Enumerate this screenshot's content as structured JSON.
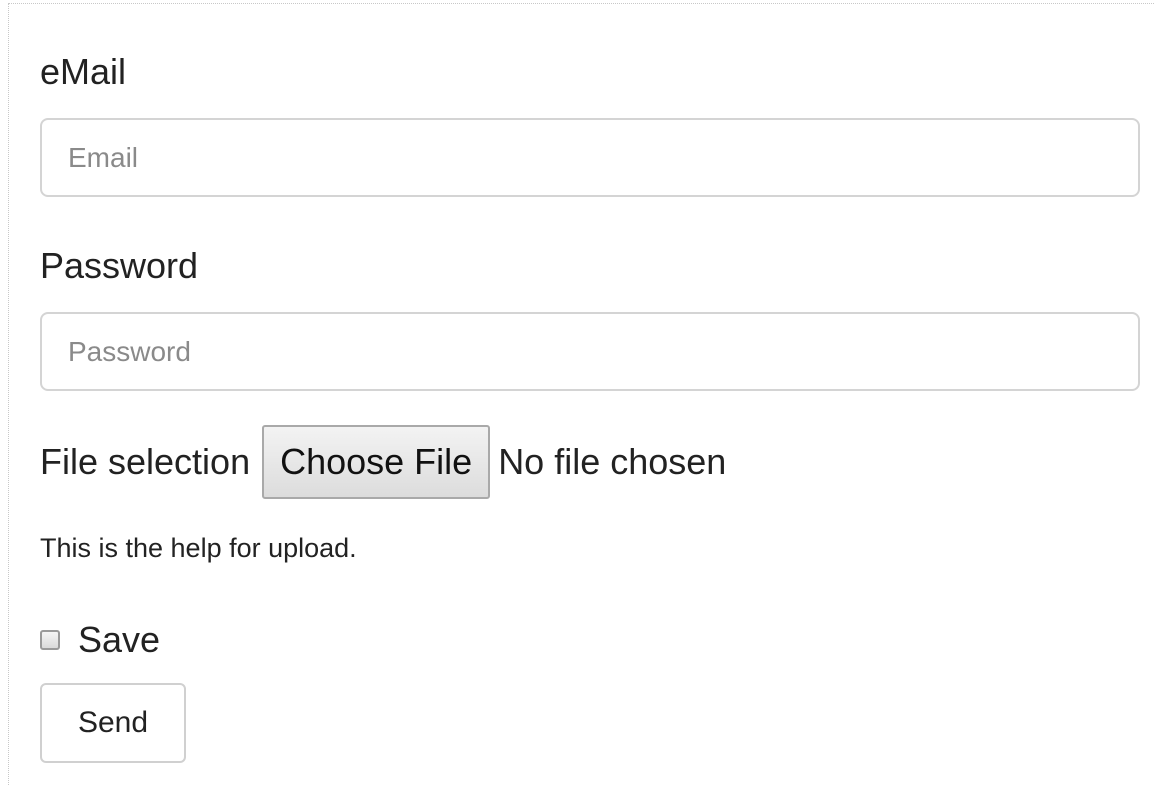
{
  "form": {
    "email": {
      "label": "eMail",
      "placeholder": "Email",
      "value": ""
    },
    "password": {
      "label": "Password",
      "placeholder": "Password",
      "value": ""
    },
    "file": {
      "label": "File selection",
      "button_label": "Choose File",
      "status": "No file chosen",
      "help": "This is the help for upload."
    },
    "save": {
      "label": "Save",
      "checked": false
    },
    "submit_label": "Send"
  },
  "colors": {
    "input_border": "#d4d4d4",
    "text": "#222222",
    "placeholder": "#8a8a8a"
  }
}
